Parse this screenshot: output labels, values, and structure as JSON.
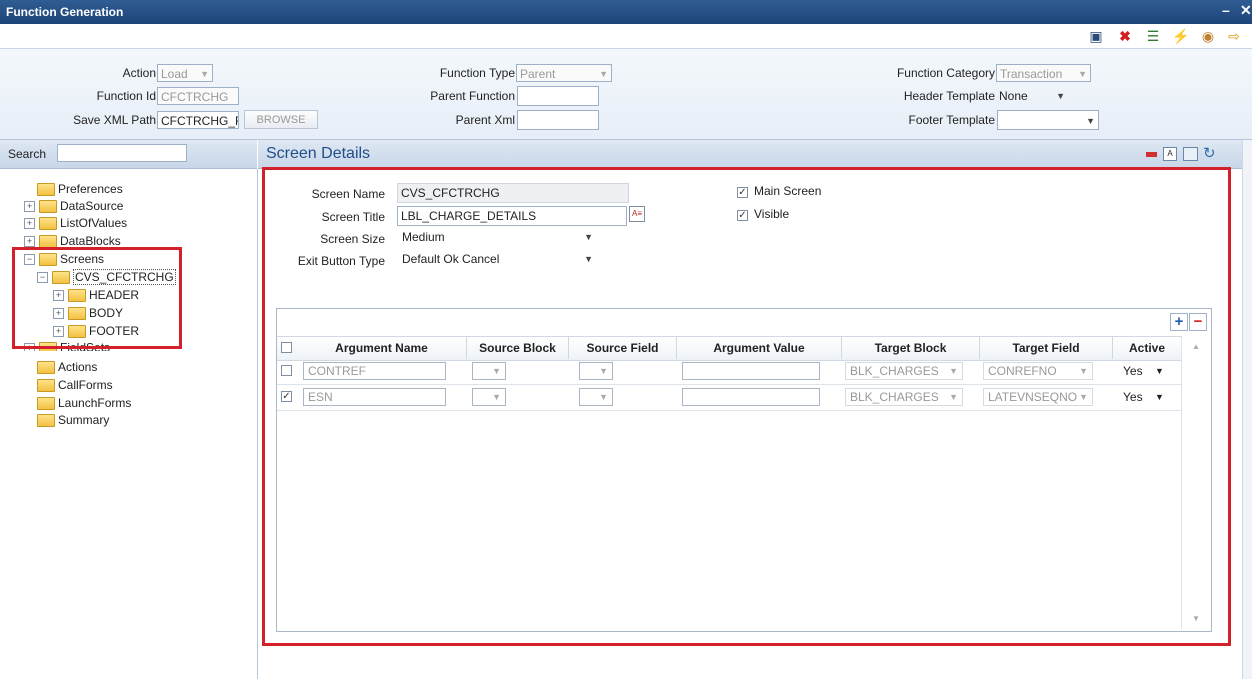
{
  "window": {
    "title": "Function Generation"
  },
  "header_form": {
    "action": {
      "label": "Action",
      "value": "Load"
    },
    "function_id": {
      "label": "Function Id",
      "value": "CFCTRCHG"
    },
    "save_xml_path": {
      "label": "Save XML Path",
      "value": "CFCTRCHG_F",
      "browse_label": "BROWSE"
    },
    "function_type": {
      "label": "Function Type",
      "value": "Parent"
    },
    "parent_function": {
      "label": "Parent Function",
      "value": ""
    },
    "parent_xml": {
      "label": "Parent Xml",
      "value": ""
    },
    "function_category": {
      "label": "Function Category",
      "value": "Transaction"
    },
    "header_template": {
      "label": "Header Template",
      "value": "None"
    },
    "footer_template": {
      "label": "Footer Template",
      "value": ""
    }
  },
  "sidebar": {
    "search_label": "Search",
    "search_value": "",
    "tree": {
      "preferences": "Preferences",
      "datasource": "DataSource",
      "listofvalues": "ListOfValues",
      "datablocks": "DataBlocks",
      "screens": "Screens",
      "cvs_screen": "CVS_CFCTRCHG",
      "header": "HEADER",
      "body": "BODY",
      "footer": "FOOTER",
      "fieldsets": "FieldSets",
      "actions": "Actions",
      "callforms": "CallForms",
      "launchforms": "LaunchForms",
      "summary": "Summary"
    }
  },
  "screen_details": {
    "title": "Screen Details",
    "screen_name": {
      "label": "Screen Name",
      "value": "CVS_CFCTRCHG"
    },
    "screen_title": {
      "label": "Screen Title",
      "value": "LBL_CHARGE_DETAILS"
    },
    "screen_size": {
      "label": "Screen Size",
      "value": "Medium"
    },
    "exit_button_type": {
      "label": "Exit Button Type",
      "value": "Default Ok Cancel"
    },
    "main_screen": {
      "label": "Main Screen",
      "checked": true
    },
    "visible": {
      "label": "Visible",
      "checked": true
    }
  },
  "grid": {
    "columns": [
      "Argument Name",
      "Source Block",
      "Source Field",
      "Argument Value",
      "Target Block",
      "Target Field",
      "Active"
    ],
    "rows": [
      {
        "checked": false,
        "argument_name": "CONTREF",
        "source_block": "",
        "source_field": "",
        "argument_value": "",
        "target_block": "BLK_CHARGES",
        "target_field": "CONREFNO",
        "active": "Yes"
      },
      {
        "checked": true,
        "argument_name": "ESN",
        "source_block": "",
        "source_field": "",
        "argument_value": "",
        "target_block": "BLK_CHARGES",
        "target_field": "LATEVNSEQNO",
        "active": "Yes"
      }
    ]
  },
  "colors": {
    "title_bar": "#1e4578",
    "highlight": "#d4202a",
    "panel_title": "#1f4f8a"
  }
}
